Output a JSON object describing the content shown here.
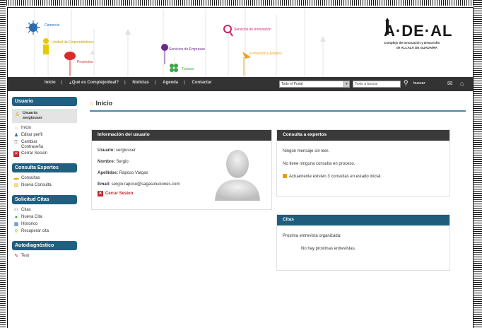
{
  "header": {
    "deco_labels": [
      "Comercio",
      "Unidad de Emprendedores",
      "Proyectos",
      "Servicios de Empresas",
      "Turismo",
      "Servicios de Innovación",
      "Formación y Empleo"
    ],
    "logo": {
      "name": "A·DE·AL",
      "subtitle_lines": [
        "Complejo de Innovación y Desarrollo",
        "de ALCALÁ DE GUADAÍRA"
      ]
    }
  },
  "nav": {
    "items": [
      "Inicio",
      "¿Qué es Complejoideal?",
      "Noticias",
      "Agenda",
      "Contactar"
    ],
    "scope_select": "Todo el Portal",
    "search_placeholder": "Texto a buscar",
    "search_button": "buscar"
  },
  "sidebar": {
    "usuario": {
      "title": "Usuario",
      "user_label": "Usuario:",
      "user_name": "sergiouser",
      "items": [
        "Inicio",
        "Editar perfil",
        "Cambiar Contraseña",
        "Cerrar Sesion"
      ]
    },
    "consulta": {
      "title": "Consulta Expertos",
      "items": [
        "Consultas",
        "Nueva Consulta"
      ]
    },
    "citas": {
      "title": "Solicitud Citas",
      "items": [
        "Citas",
        "Nueva Cita",
        "Historico",
        "Recuperar cita"
      ]
    },
    "autodiag": {
      "title": "Autodiagnóstico",
      "items": [
        "Test"
      ]
    }
  },
  "main": {
    "title": "Inicio",
    "user_panel": {
      "title": "Información del usuario",
      "usuario_label": "Usuario:",
      "usuario": "sergiouser",
      "nombre_label": "Nombre:",
      "nombre": "Sergio",
      "apellidos_label": "Apellidos:",
      "apellidos": "Raposo Vargas",
      "email_label": "Email:",
      "email": "sergio.raposo@sagasoluciones.com",
      "logout": "Cerrar Sesion"
    },
    "consulta_panel": {
      "title": "Consulta a expertos",
      "line1": "Ningún mensaje sin leer.",
      "line2": "No tiene ninguna consulta en proceso.",
      "line3": "Actuamente existen 3 consultas en estado inicial"
    },
    "citas_panel": {
      "title": "Citas",
      "line1": "Proxima entrevista organizada:",
      "line2": "No hay proximas entrevistas."
    }
  },
  "colors": {
    "nav_bg": "#333333",
    "sidebar_title_bg": "#1f5f7f",
    "panel_dark": "#3a3a3a",
    "panel_blue": "#1e5e7c",
    "accent_red": "#c0272d",
    "accent_orange": "#e8a000"
  }
}
